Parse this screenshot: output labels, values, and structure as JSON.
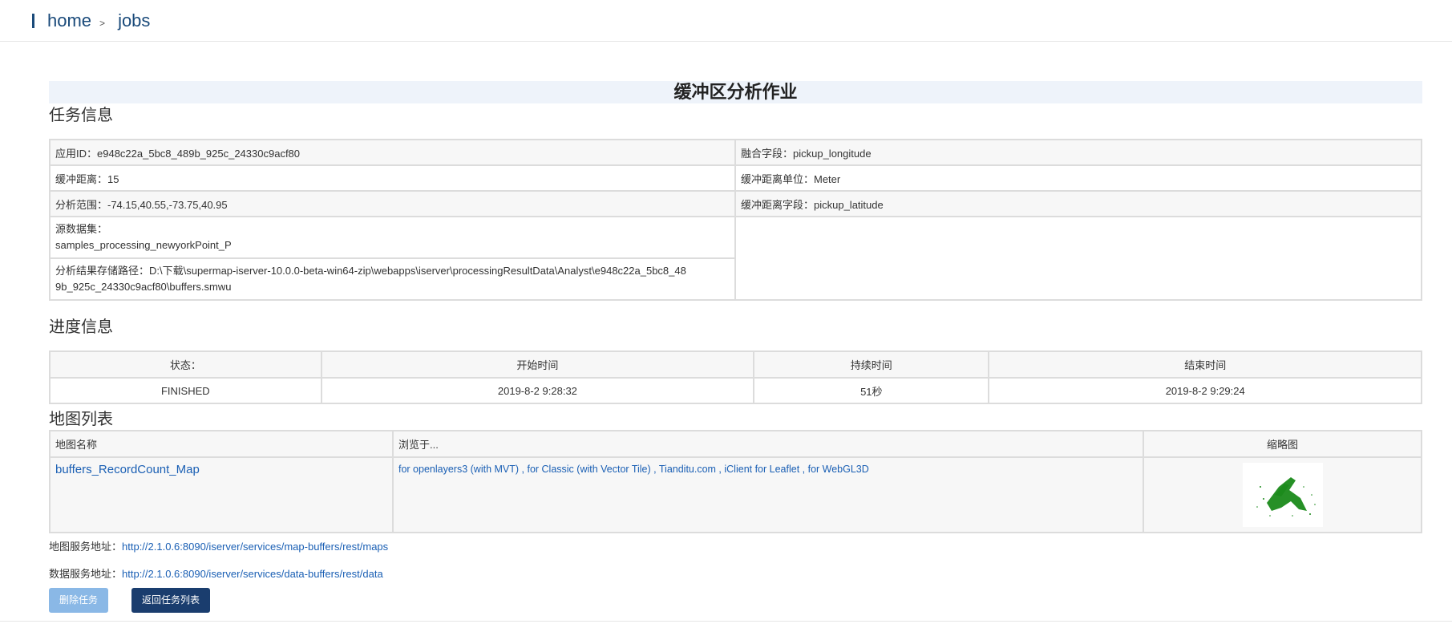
{
  "breadcrumb": {
    "home": "home",
    "separator": ">",
    "current": "jobs"
  },
  "page_title": "缓冲区分析作业",
  "task_info": {
    "section_title": "任务信息",
    "app_id": "应用ID：e948c22a_5bc8_489b_925c_24330c9acf80",
    "dissolve_field": "融合字段：pickup_longitude",
    "buffer_distance": "缓冲距离：15",
    "buffer_distance_unit": "缓冲距离单位：Meter",
    "analysis_bounds": "分析范围：-74.15,40.55,-73.75,40.95",
    "buffer_distance_field": "缓冲距离字段：pickup_latitude",
    "source_dataset_label": "源数据集：",
    "source_dataset_value": "samples_processing_newyorkPoint_P",
    "result_path_line1": "分析结果存储路径：D:\\下载\\supermap-iserver-10.0.0-beta-win64-zip\\webapps\\iserver\\processingResultData\\Analyst\\e948c22a_5bc8_48",
    "result_path_line2": "9b_925c_24330c9acf80\\buffers.smwu"
  },
  "progress_info": {
    "section_title": "进度信息",
    "headers": [
      "状态：",
      "开始时间",
      "持续时间",
      "结束时间"
    ],
    "values": [
      "FINISHED",
      "2019-8-2 9:28:32",
      "51秒",
      "2019-8-2 9:29:24"
    ]
  },
  "map_list": {
    "section_title": "地图列表",
    "headers": {
      "name": "地图名称",
      "browse": "浏览于...",
      "thumbnail": "缩略图"
    },
    "rows": [
      {
        "name": "buffers_RecordCount_Map",
        "browse": "for openlayers3 (with MVT) , for Classic (with Vector Tile) , Tianditu.com , iClient for Leaflet , for WebGL3D",
        "thumbnail_color": "#1a8a1a"
      }
    ]
  },
  "map_service": {
    "label": "地图服务地址：",
    "url": "http://2.1.0.6:8090/iserver/services/map-buffers/rest/maps"
  },
  "data_service": {
    "label": "数据服务地址：",
    "url": "http://2.1.0.6:8090/iserver/services/data-buffers/rest/data"
  },
  "buttons": {
    "delete": "删除任务",
    "back": "返回任务列表"
  },
  "colors": {
    "accent": "#1a3d6e",
    "link": "#1a5fb4",
    "title_bg": "#eef3fa"
  }
}
